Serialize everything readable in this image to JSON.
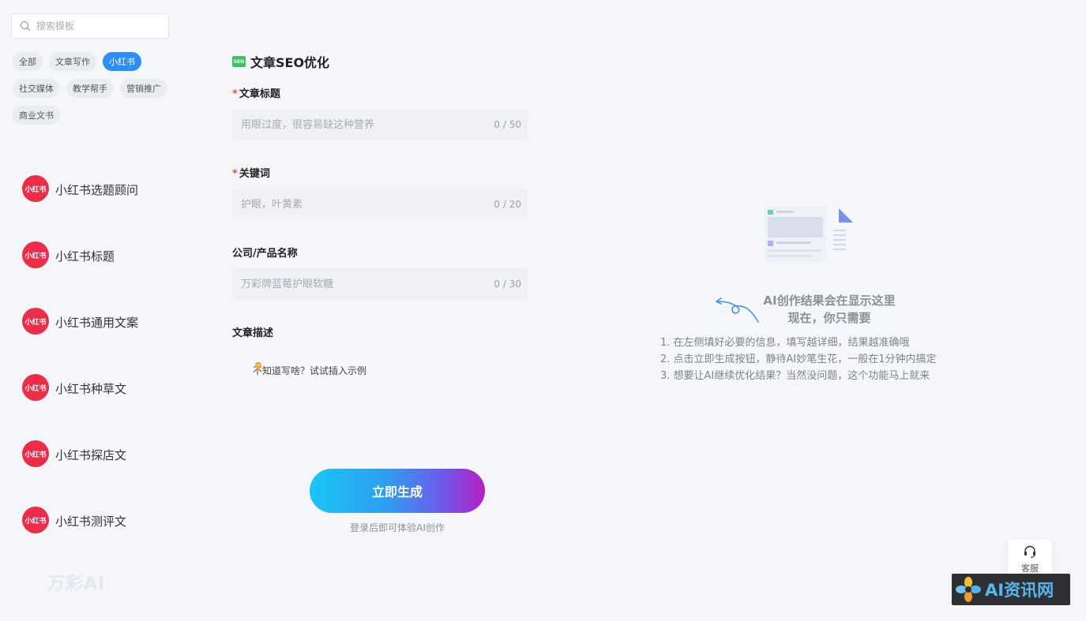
{
  "sidebar": {
    "search_placeholder": "搜索模板",
    "tags": [
      {
        "label": "全部",
        "active": false
      },
      {
        "label": "文章写作",
        "active": false
      },
      {
        "label": "小红书",
        "active": true
      },
      {
        "label": "社交媒体",
        "active": false
      },
      {
        "label": "教学帮手",
        "active": false
      },
      {
        "label": "营销推广",
        "active": false
      },
      {
        "label": "商业文书",
        "active": false
      }
    ],
    "templates": [
      {
        "label": "小红书选题顾问",
        "avatar_text": "小红书"
      },
      {
        "label": "小红书标题",
        "avatar_text": "小红书"
      },
      {
        "label": "小红书通用文案",
        "avatar_text": "小红书"
      },
      {
        "label": "小红书种草文",
        "avatar_text": "小红书"
      },
      {
        "label": "小红书探店文",
        "avatar_text": "小红书"
      },
      {
        "label": "小红书测评文",
        "avatar_text": "小红书"
      }
    ],
    "brand": "万彩AI"
  },
  "form": {
    "badge": "SEO",
    "title": "文章SEO优化",
    "required_mark": "*",
    "fields": {
      "article_title": {
        "label": "文章标题",
        "placeholder": "用眼过度，很容易缺这种营养",
        "value": "",
        "counter": "0 / 50"
      },
      "keywords": {
        "label": "关键词",
        "placeholder": "护眼，叶黄素",
        "value": "",
        "counter": "0 / 20"
      },
      "company": {
        "label": "公司/产品名称",
        "placeholder": "万彩牌蓝莓护眼软糖",
        "value": "",
        "counter": "0 / 30"
      },
      "description": {
        "label": "文章描述",
        "example_link": "不知道写啥？试试插入示例"
      }
    },
    "generate_button": "立即生成",
    "generate_hint": "登录后即可体验AI创作"
  },
  "result": {
    "title_line1": "AI创作结果会在显示这里",
    "title_line2": "现在，你只需要",
    "steps": [
      "1. 在左侧填好必要的信息，填写越详细，结果越准确哦",
      "2. 点击立即生成按钮，静待AI妙笔生花，一般在1分钟内搞定",
      "3. 想要让AI继续优化结果？当然没问题，这个功能马上就来"
    ]
  },
  "service": {
    "label": "客服"
  },
  "watermark": {
    "text": "AI资讯网"
  },
  "colors": {
    "accent": "#2e8df7",
    "xhs_red": "#ec2d47",
    "seo_green": "#3fbf66",
    "required": "#f04b4b"
  },
  "icons": {
    "search": "search-icon",
    "headset": "headset-icon",
    "bulb": "lightbulb-icon"
  }
}
